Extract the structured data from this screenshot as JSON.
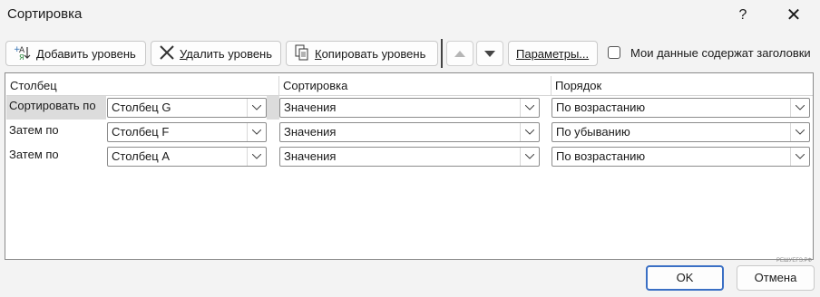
{
  "window": {
    "title": "Сортировка",
    "help": "?",
    "close": "✕"
  },
  "toolbar": {
    "add_level": {
      "label": "Добавить уровень",
      "prefix": "Д",
      "rest": "обавить уровень"
    },
    "delete_level": {
      "label": "Удалить уровень",
      "prefix": "У",
      "rest": "далить уровень"
    },
    "copy_level": {
      "label": "Копировать уровень",
      "prefix": "К",
      "rest": "опировать уровень"
    },
    "options": {
      "label": "Параметры...",
      "prefix": "П",
      "rest": "араметры..."
    },
    "has_headers": {
      "label": "Мои данные содержат заголовки",
      "checked": false
    }
  },
  "columns": {
    "column": "Столбец",
    "sort_on": "Сортировка",
    "order": "Порядок"
  },
  "rows": [
    {
      "label": "Сортировать по",
      "column": "Столбец G",
      "sort_on": "Значения",
      "order": "По возрастанию",
      "selected": true
    },
    {
      "label": "Затем по",
      "column": "Столбец F",
      "sort_on": "Значения",
      "order": "По убыванию",
      "selected": false
    },
    {
      "label": "Затем по",
      "column": "Столбец A",
      "sort_on": "Значения",
      "order": "По возрастанию",
      "selected": false
    }
  ],
  "footer": {
    "ok": "OK",
    "cancel": "Отмена"
  },
  "watermark": "РЕШУЕГЭ.РФ",
  "colors": {
    "accent": "#3a6fc4",
    "selected_row": "#dcdcdc",
    "background": "#f3f3f3"
  }
}
